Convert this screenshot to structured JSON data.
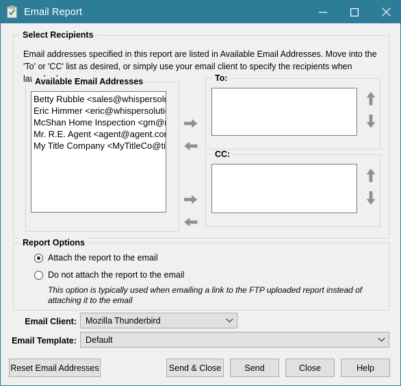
{
  "window": {
    "title": "Email Report",
    "icon": "clipboard-check-icon",
    "titlebar_color": "#2d7d99",
    "caption": {
      "minimize": "minimize-icon",
      "maximize": "maximize-icon",
      "close": "close-icon"
    }
  },
  "select_recipients": {
    "legend": "Select Recipients",
    "description": "Email addresses specified in this report are listed in Available Email Addresses.  Move into the 'To' or 'CC' list as desired, or simply use your email client to specify the recipients when launched.",
    "available": {
      "legend": "Available Email Addresses",
      "items": [
        "Betty Rubble <sales@whispersolutions",
        "Eric Himmer <eric@whispersolutions",
        "McShan Home Inspection <gm@mc",
        "Mr. R.E. Agent <agent@agent.com>",
        "My Title Company <MyTitleCo@title"
      ]
    },
    "to": {
      "legend": "To:",
      "items": []
    },
    "cc": {
      "legend": "CC:",
      "items": []
    },
    "move_buttons": {
      "to_right": "arrow-right-icon",
      "to_left": "arrow-left-icon",
      "cc_right": "arrow-right-icon",
      "cc_left": "arrow-left-icon"
    },
    "order_buttons": {
      "to_up": "arrow-up-icon",
      "to_down": "arrow-down-icon",
      "cc_up": "arrow-up-icon",
      "cc_down": "arrow-down-icon"
    }
  },
  "report_options": {
    "legend": "Report Options",
    "options": [
      {
        "label": "Attach the report to the email",
        "selected": true
      },
      {
        "label": "Do not attach the report to the email",
        "selected": false
      }
    ],
    "hint": "This option is typically used when emailing a link to the FTP uploaded report instead of attaching it to the email"
  },
  "email_client": {
    "label": "Email Client:",
    "value": "Mozilla Thunderbird"
  },
  "email_template": {
    "label": "Email Template:",
    "value": "Default"
  },
  "footer": {
    "reset": "Reset Email Addresses",
    "send_and_close": "Send & Close",
    "send": "Send",
    "close": "Close",
    "help": "Help"
  }
}
